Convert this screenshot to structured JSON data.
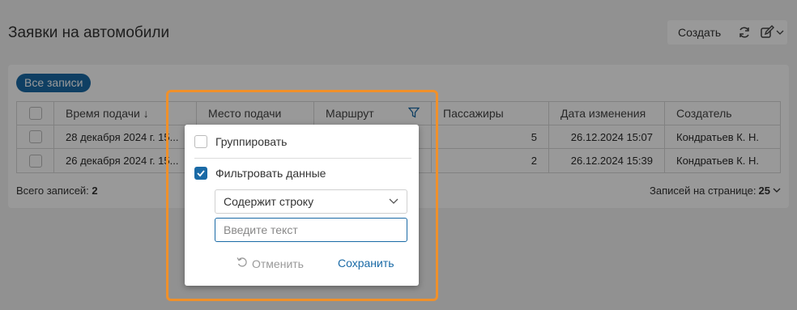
{
  "page": {
    "title": "Заявки на автомобили"
  },
  "toolbar": {
    "create_label": "Создать",
    "icons": [
      "refresh-icon",
      "edit-icon",
      "chevron-down-icon"
    ]
  },
  "filter_chip": {
    "label": "Все записи"
  },
  "table": {
    "columns": [
      "Время подачи",
      "Место подачи",
      "Маршрут",
      "Пассажиры",
      "Дата изменения",
      "Создатель"
    ],
    "sort_arrow": "↓",
    "rows": [
      {
        "time": "28 декабря 2024 г. 15...",
        "place": "",
        "route": "",
        "passengers": "5",
        "modified": "26.12.2024 15:07",
        "creator": "Кондратьев К. Н."
      },
      {
        "time": "26 декабря 2024 г. 15...",
        "place": "",
        "route": "",
        "passengers": "2",
        "modified": "26.12.2024 15:39",
        "creator": "Кондратьев К. Н."
      }
    ]
  },
  "footer": {
    "total_label": "Всего записей:",
    "total_value": "2",
    "per_page_label": "Записей на странице:",
    "per_page_value": "25"
  },
  "popup": {
    "group_label": "Группировать",
    "group_checked": false,
    "filter_label": "Фильтровать данные",
    "filter_checked": true,
    "condition_value": "Содержит строку",
    "input_placeholder": "Введите текст",
    "cancel_label": "Отменить",
    "save_label": "Сохранить"
  },
  "colors": {
    "accent": "#1a6aa6",
    "highlight": "#f0902a"
  }
}
